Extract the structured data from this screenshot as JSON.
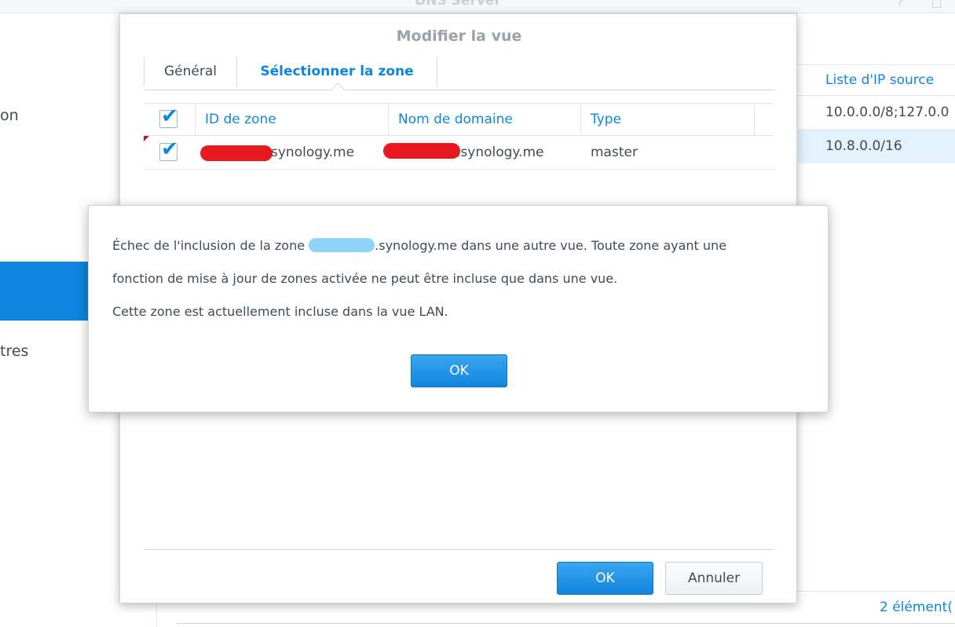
{
  "app": {
    "title": "DNS Server",
    "ctrl_help": "?",
    "ctrl_max": "□"
  },
  "sidebar": {
    "items": [
      {
        "label": "on"
      },
      {
        "label": "tres"
      }
    ]
  },
  "background_table": {
    "header": "Liste d'IP source",
    "rows": [
      "10.0.0.0/8;127.0.0",
      "10.8.0.0/16"
    ],
    "count": "2 élément("
  },
  "dialog": {
    "title": "Modifier la vue",
    "tabs": [
      {
        "label": "Général"
      },
      {
        "label": "Sélectionner la zone"
      }
    ],
    "grid": {
      "headers": {
        "zone_id": "ID de zone",
        "domain": "Nom de domaine",
        "type": "Type"
      },
      "rows": [
        {
          "zone_id": "synology.me",
          "domain": ".synology.me",
          "type": "master"
        }
      ]
    },
    "ok_label": "OK",
    "cancel_label": "Annuler"
  },
  "message": {
    "line1_before": "Échec de l'inclusion de la zone ",
    "line1_after": ".synology.me dans une autre vue. Toute zone ayant une",
    "line2": "fonction de mise à jour de zones activée ne peut être incluse que dans une vue.",
    "line3": "Cette zone est actuellement incluse dans la vue LAN.",
    "ok_label": "OK"
  },
  "icons": {
    "check_glyph": "✔"
  }
}
